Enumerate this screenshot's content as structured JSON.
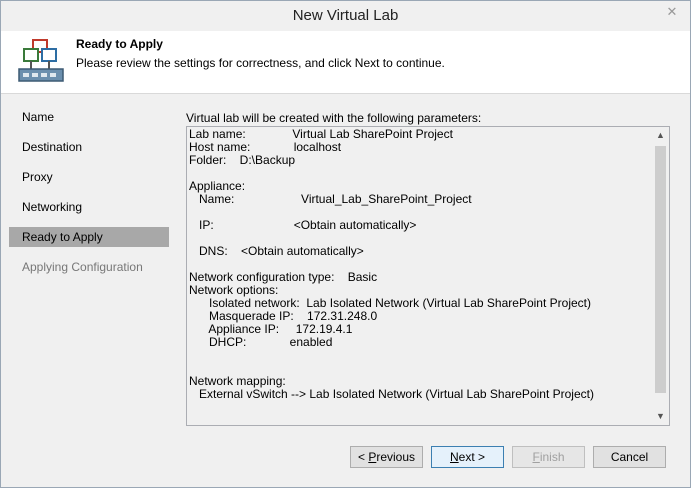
{
  "window": {
    "title": "New Virtual Lab",
    "close_glyph": "✕"
  },
  "header": {
    "title": "Ready to Apply",
    "description": "Please review the settings for correctness, and click Next to continue."
  },
  "sidebar": {
    "items": [
      {
        "label": "Name",
        "state": "normal"
      },
      {
        "label": "Destination",
        "state": "normal"
      },
      {
        "label": "Proxy",
        "state": "normal"
      },
      {
        "label": "Networking",
        "state": "normal"
      },
      {
        "label": "Ready to Apply",
        "state": "selected"
      },
      {
        "label": "Applying Configuration",
        "state": "disabled"
      }
    ]
  },
  "main": {
    "label": "Virtual lab will be created with the following parameters:",
    "parameters": [
      "Lab name:              Virtual Lab SharePoint Project",
      "Host name:             localhost",
      "Folder:    D:\\Backup",
      "",
      "Appliance:",
      "   Name:                    Virtual_Lab_SharePoint_Project",
      "",
      "   IP:                        <Obtain automatically>",
      "",
      "   DNS:    <Obtain automatically>",
      "",
      "Network configuration type:    Basic",
      "Network options:",
      "      Isolated network:  Lab Isolated Network (Virtual Lab SharePoint Project)",
      "      Masquerade IP:    172.31.248.0",
      "      Appliance IP:     172.19.4.1",
      "      DHCP:             enabled",
      "",
      "",
      "Network mapping:",
      "   External vSwitch --> Lab Isolated Network (Virtual Lab SharePoint Project)"
    ]
  },
  "buttons": {
    "previous": {
      "pre": "< ",
      "accel": "P",
      "post": "revious"
    },
    "next": {
      "pre": "",
      "accel": "N",
      "post": "ext >"
    },
    "finish": {
      "pre": "",
      "accel": "F",
      "post": "inish"
    },
    "cancel": {
      "label": "Cancel"
    }
  },
  "icons": {
    "header_icon": "virtual-lab-icon",
    "scroll_up": "▲",
    "scroll_down": "▼"
  }
}
